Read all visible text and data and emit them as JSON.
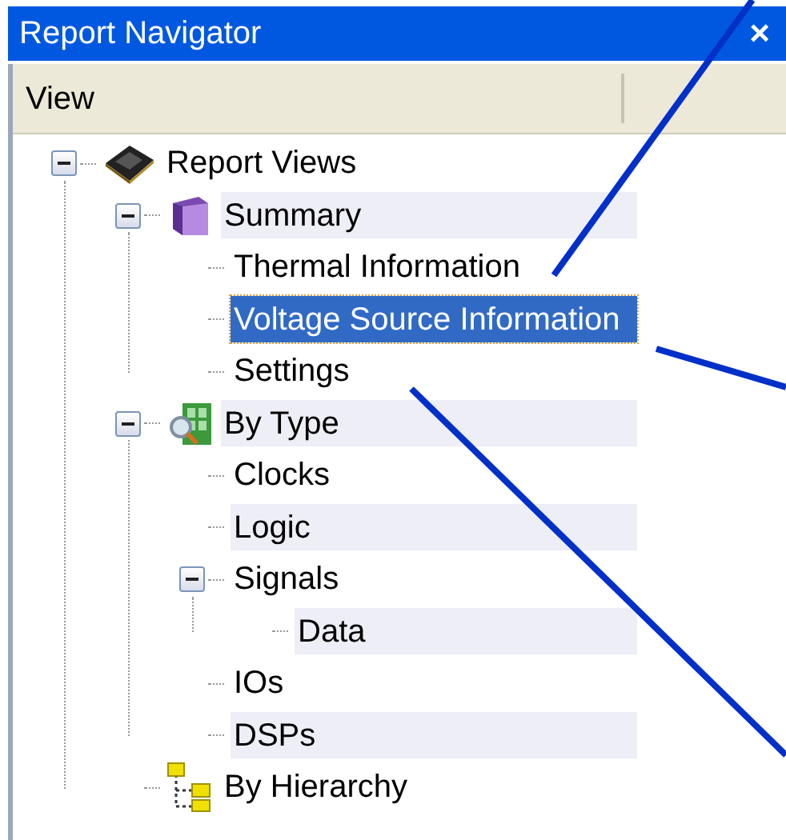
{
  "window": {
    "title": "Report Navigator",
    "close": "×"
  },
  "header": {
    "columns": [
      "View"
    ]
  },
  "tree": [
    {
      "label": "Report Views",
      "kind": "chip",
      "expanded": true,
      "selected": false,
      "children": [
        {
          "label": "Summary",
          "kind": "book",
          "expanded": true,
          "selected": false,
          "children": [
            {
              "label": "Thermal Information",
              "selected": false
            },
            {
              "label": "Voltage Source Information",
              "selected": true
            },
            {
              "label": "Settings",
              "selected": false
            }
          ]
        },
        {
          "label": "By Type",
          "kind": "grid-search",
          "expanded": true,
          "selected": false,
          "children": [
            {
              "label": "Clocks",
              "selected": false
            },
            {
              "label": "Logic",
              "selected": false
            },
            {
              "label": "Signals",
              "expanded": true,
              "selected": false,
              "children": [
                {
                  "label": "Data",
                  "selected": false
                }
              ]
            },
            {
              "label": "IOs",
              "selected": false
            },
            {
              "label": "DSPs",
              "selected": false
            }
          ]
        },
        {
          "label": "By Hierarchy",
          "kind": "hierarchy",
          "selected": false
        }
      ]
    }
  ]
}
